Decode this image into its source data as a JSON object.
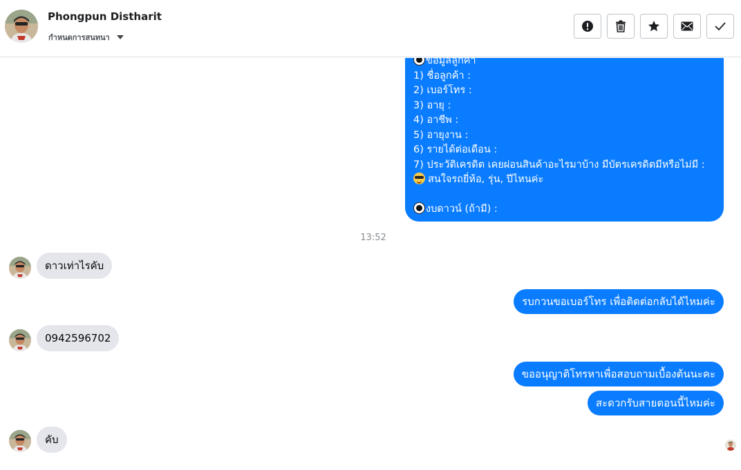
{
  "header": {
    "name": "Phongpun Distharit",
    "subtitle": "กำหนดการสนทนา",
    "actions": [
      {
        "name": "mark-spam-button",
        "icon": "alert-icon"
      },
      {
        "name": "delete-button",
        "icon": "trash-icon"
      },
      {
        "name": "star-button",
        "icon": "star-icon"
      },
      {
        "name": "mark-unread-button",
        "icon": "envelope-icon"
      },
      {
        "name": "mark-done-button",
        "icon": "check-icon"
      }
    ]
  },
  "customer_info_message": {
    "lines": [
      "ข้อมูลลูกค้า",
      "1) ชื่อลูกค้า :",
      "2) เบอร์โทร :",
      "3) อายุ :",
      "4) อาชีพ :",
      "5) อายุงาน :",
      "6) รายได้ต่อเดือน :",
      "7) ประวัติเครดิต  เคยผ่อนสินค้าอะไรมาบ้าง มีบัตรเครดิตมีหรือไม่มี :",
      "สนใจรถยี่ห้อ, รุ่น, ปีไหนค่ะ",
      "",
      "งบดาวน์ (ถ้ามี) :"
    ]
  },
  "timestamp": "13:52",
  "messages": {
    "in_1": "ดาวเท่าไรคับ",
    "out_1": "รบกวนขอเบอร์โทร เพื่อติดต่อกลับได้ไหมค่ะ",
    "in_2": "0942596702",
    "out_2": "ขออนุญาติโทรหาเพื่อสอบถามเบื้องต้นนะคะ",
    "out_3": "สะดวกรับสายตอนนี้ไหมค่ะ",
    "in_3": "คับ"
  },
  "colors": {
    "outgoing_bubble": "#0a7cff",
    "incoming_bubble": "#e4e6eb"
  }
}
